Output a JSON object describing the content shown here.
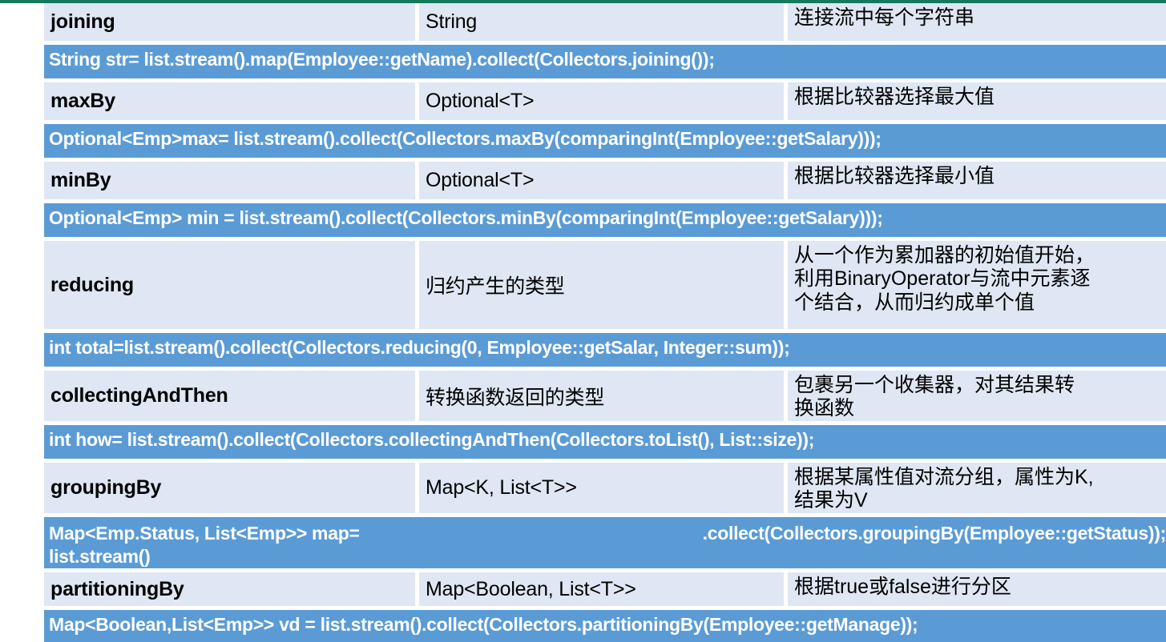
{
  "theme": {
    "accent_blue": "#5B9BD5",
    "cell_light": "#DEE7F3",
    "top_rule_green": "#16795E",
    "code_text": "#FFFFFF",
    "body_text": "#000000"
  },
  "table": {
    "rows": [
      {
        "type": "desc",
        "name": "joining",
        "return_type": "String",
        "description": [
          "连接流中每个字符串"
        ]
      },
      {
        "type": "code",
        "lines": [
          "String str= list.stream().map(Employee::getName).collect(Collectors.joining());"
        ]
      },
      {
        "type": "desc",
        "name": "maxBy",
        "return_type": "Optional<T>",
        "description": [
          "根据比较器选择最大值"
        ]
      },
      {
        "type": "code",
        "lines": [
          "Optional<Emp>max= list.stream().collect(Collectors.maxBy(comparingInt(Employee::getSalary)));"
        ]
      },
      {
        "type": "desc",
        "name": "minBy",
        "return_type": "Optional<T>",
        "description": [
          "根据比较器选择最小值"
        ]
      },
      {
        "type": "code",
        "lines": [
          "Optional<Emp> min = list.stream().collect(Collectors.minBy(comparingInt(Employee::getSalary)));"
        ]
      },
      {
        "type": "desc",
        "name": "reducing",
        "return_type": "归约产生的类型",
        "description": [
          "从一个作为累加器的初始值开始，",
          "利用BinaryOperator与流中元素逐",
          "个结合，从而归约成单个值"
        ]
      },
      {
        "type": "code",
        "lines": [
          "int total=list.stream().collect(Collectors.reducing(0, Employee::getSalar, Integer::sum));"
        ]
      },
      {
        "type": "desc",
        "name": "collectingAndThen",
        "return_type": "转换函数返回的类型",
        "description": [
          "包裹另一个收集器，对其结果转",
          "换函数"
        ]
      },
      {
        "type": "code",
        "lines": [
          "int how= list.stream().collect(Collectors.collectingAndThen(Collectors.toList(), List::size));"
        ]
      },
      {
        "type": "desc",
        "name": "groupingBy",
        "return_type": "Map<K, List<T>>",
        "description": [
          "根据某属性值对流分组，属性为K,",
          "结果为V"
        ]
      },
      {
        "type": "code",
        "lines": [
          "Map<Emp.Status, List<Emp>> map= list.stream()",
          ".collect(Collectors.groupingBy(Employee::getStatus));"
        ],
        "second_line_indented": true
      },
      {
        "type": "desc",
        "name": "partitioningBy",
        "return_type": "Map<Boolean, List<T>>",
        "description": [
          "根据true或false进行分区"
        ]
      },
      {
        "type": "code",
        "lines": [
          "Map<Boolean,List<Emp>> vd = list.stream().collect(Collectors.partitioningBy(Employee::getManage));"
        ]
      }
    ]
  }
}
